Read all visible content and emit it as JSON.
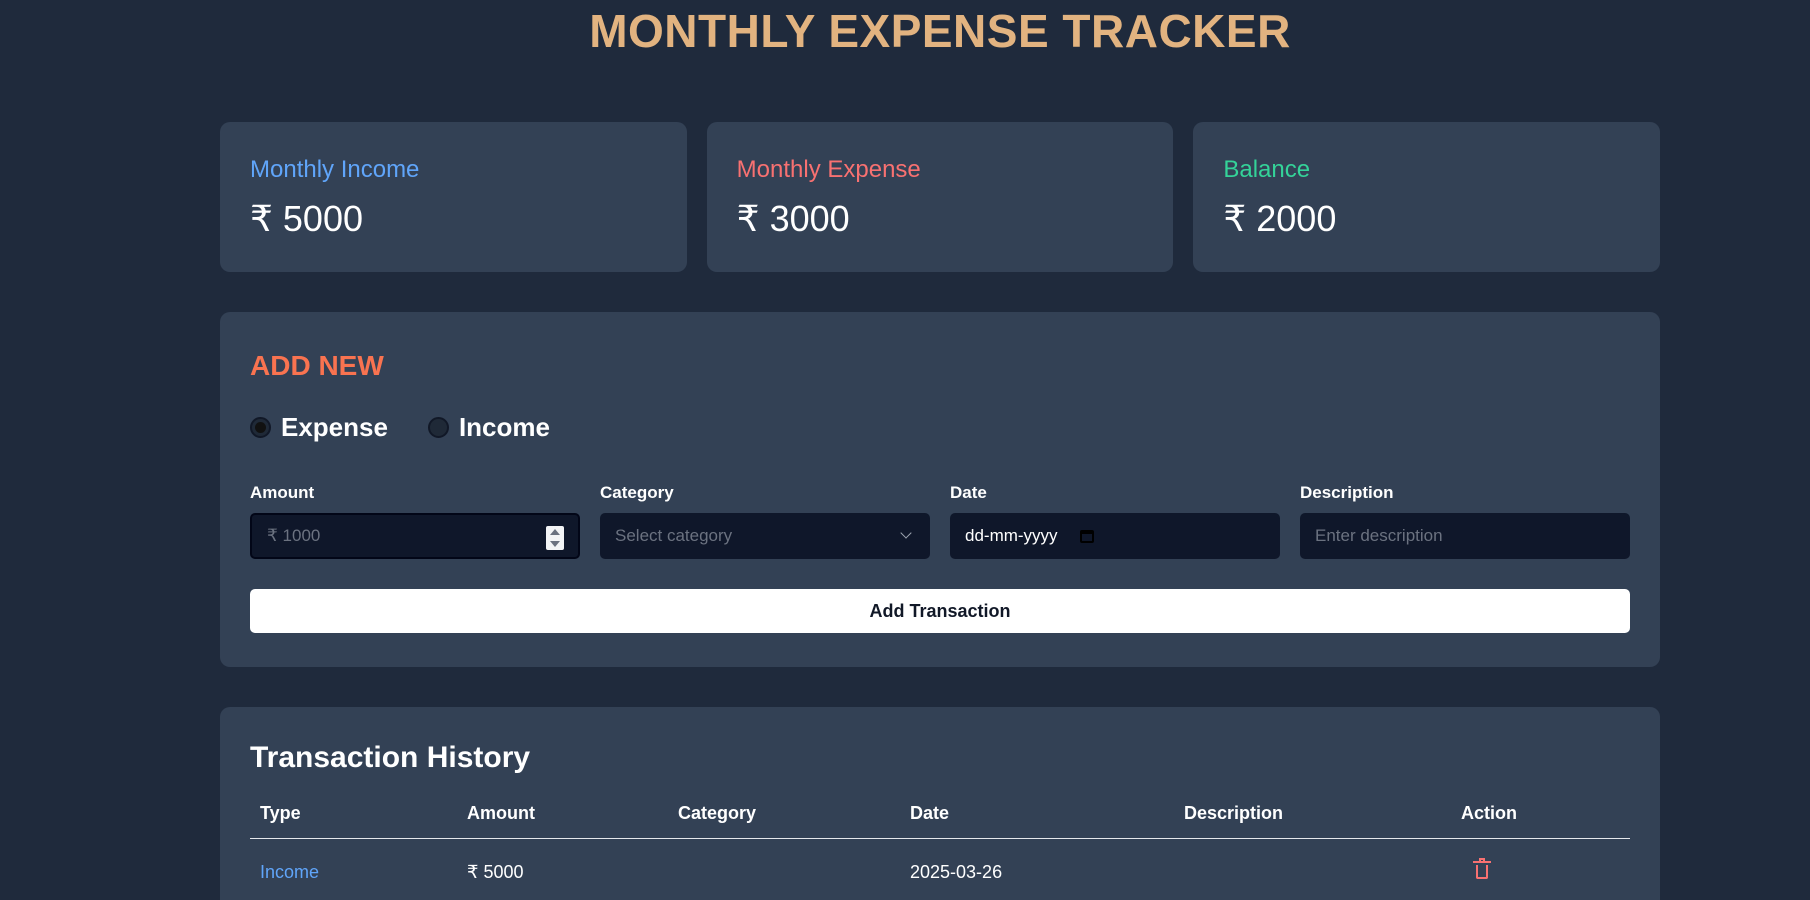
{
  "app": {
    "title": "MONTHLY EXPENSE TRACKER"
  },
  "summary": [
    {
      "label": "Monthly Income",
      "value": "₹ 5000",
      "color": "#60a5fa"
    },
    {
      "label": "Monthly Expense",
      "value": "₹ 3000",
      "color": "#f87171"
    },
    {
      "label": "Balance",
      "value": "₹ 2000",
      "color": "#34d399"
    }
  ],
  "add_form": {
    "title": "ADD NEW",
    "type_options": [
      {
        "label": "Expense",
        "checked": true
      },
      {
        "label": "Income",
        "checked": false
      }
    ],
    "amount": {
      "label": "Amount",
      "placeholder": "₹ 1000"
    },
    "category": {
      "label": "Category",
      "placeholder": "Select category"
    },
    "date": {
      "label": "Date",
      "value": "dd-mm-yyyy"
    },
    "description": {
      "label": "Description",
      "placeholder": "Enter description"
    },
    "submit_label": "Add Transaction"
  },
  "history": {
    "title": "Transaction History",
    "columns": [
      "Type",
      "Amount",
      "Category",
      "Date",
      "Description",
      "Action"
    ],
    "rows": [
      {
        "type": "Income",
        "amount": "₹ 5000",
        "category": "",
        "date": "2025-03-26",
        "description": "",
        "action_icon": "trash-icon"
      }
    ]
  }
}
